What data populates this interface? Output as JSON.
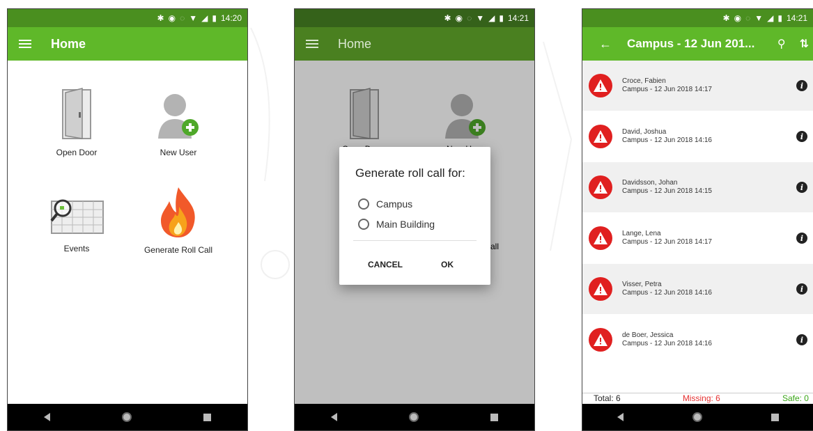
{
  "colors": {
    "green": "#5fb829",
    "green_status": "#4a8f1f",
    "alert_red": "#e02020",
    "missing_red": "#e53030",
    "safe_green": "#3aa617"
  },
  "phone1": {
    "status_time": "14:20",
    "title": "Home",
    "tiles": [
      {
        "label": "Open Door",
        "icon": "door-icon"
      },
      {
        "label": "New User",
        "icon": "new-user-icon"
      },
      {
        "label": "Events",
        "icon": "events-calendar-icon"
      },
      {
        "label": "Generate Roll Call",
        "icon": "fire-icon"
      }
    ]
  },
  "phone2": {
    "status_time": "14:21",
    "title": "Home",
    "bg_labels": {
      "open_door": "Open Door",
      "new_user": "New User",
      "roll_call_partial": "all"
    },
    "dialog": {
      "title": "Generate roll call for:",
      "options": [
        "Campus",
        "Main Building"
      ],
      "cancel": "CANCEL",
      "ok": "OK"
    }
  },
  "phone3": {
    "status_time": "14:21",
    "title": "Campus - 12 Jun 201...",
    "rows": [
      {
        "name": "Croce, Fabien",
        "detail": "Campus - 12 Jun 2018 14:17"
      },
      {
        "name": "David, Joshua",
        "detail": "Campus - 12 Jun 2018 14:16"
      },
      {
        "name": "Davidsson, Johan",
        "detail": "Campus - 12 Jun 2018 14:15"
      },
      {
        "name": "Lange, Lena",
        "detail": "Campus - 12 Jun 2018 14:17"
      },
      {
        "name": "Visser, Petra",
        "detail": "Campus - 12 Jun 2018 14:16"
      },
      {
        "name": "de Boer, Jessica",
        "detail": "Campus - 12 Jun 2018 14:16"
      }
    ],
    "footer": {
      "total": "Total: 6",
      "missing": "Missing: 6",
      "safe": "Safe: 0"
    }
  }
}
